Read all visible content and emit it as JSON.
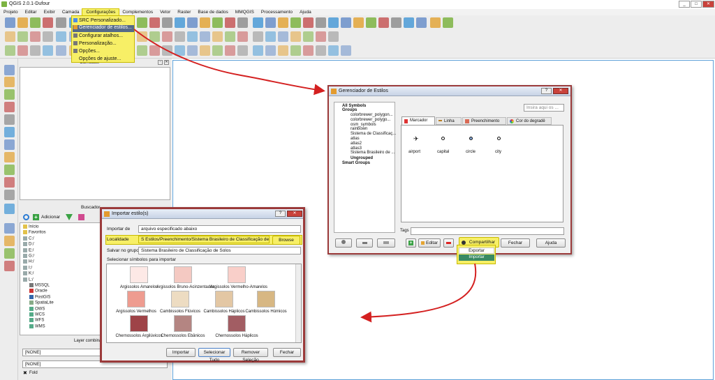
{
  "window": {
    "title": "QGIS 2.0.1-Dufour"
  },
  "menubar": {
    "items": [
      "Projeto",
      "Editar",
      "Exibir",
      "Camada",
      "Configurações",
      "Complementos",
      "Vetor",
      "Raster",
      "Base de dados",
      "MMQGIS",
      "Processamento",
      "Ajuda"
    ]
  },
  "config_menu": {
    "items": [
      "SRC Personalizado...",
      "Gerenciador de estilos...",
      "Configurar atalhos...",
      "Personalização...",
      "Opções...",
      "Opções de ajuste..."
    ]
  },
  "layers_panel": {
    "title": "Camadas"
  },
  "browser_panel": {
    "title": "Buscador",
    "add_label": "Adicionar",
    "items": [
      "Início",
      "Favoritos",
      "C:/",
      "D:/",
      "E:/",
      "G:/",
      "H:/",
      "I:/",
      "K:/",
      "L:/",
      "MSSQL",
      "Oracle",
      "PostGIS",
      "SpatiaLite",
      "OWS",
      "WCS",
      "WFS",
      "WMS"
    ]
  },
  "bottom": {
    "layer_combo_label": "Layer combinati",
    "none1": "[NONE]",
    "none2": "[NONE]",
    "fold_label": "Fold"
  },
  "style_manager": {
    "title": "Gerenciador de Estilos",
    "search_placeholder": "Insira aqui os ...",
    "tree": {
      "all": "All Symbols",
      "groups": "Groups",
      "group_items": [
        "colorbrewer_polygon...",
        "colorbrewer_polygo...",
        "osm_symbols",
        "rainbown",
        "Sistema de Classificaç...",
        "atlas",
        "atlas2",
        "atlas3",
        "Sistema Brasileiro de ..."
      ],
      "ungrouped": "Ungrouped",
      "smart": "Smart Groups"
    },
    "tabs": [
      "Marcador",
      "Linha",
      "Preenchimento",
      "Cor do degradê"
    ],
    "symbols": [
      "airport",
      "capital",
      "circle",
      "city"
    ],
    "tags_label": "Tags",
    "buttons": {
      "editar": "Editar",
      "compartilhar": "Compartilhar",
      "fechar": "Fechar",
      "ajuda": "Ajuda"
    },
    "share_menu": [
      "Exportar",
      "Importar"
    ]
  },
  "import_dialog": {
    "title": "Importar estilo(s)",
    "importar_de_label": "Importar de",
    "importar_de_value": "arquivo especificado abaixo",
    "localidade_label": "Localidade",
    "localidade_value": "S Estilos/Preenchimento/Sistema Brasileiro de Classificação de Solos.xml",
    "browse": "Browse",
    "salvar_label": "Salvar no grupo",
    "salvar_value": "Sistema Brasileiro de Classificação de Solos",
    "selecionar_label": "Selecionar símbolos para importar",
    "symbols": [
      {
        "name": "Argissolos Amarelos",
        "color": "#fde9e6"
      },
      {
        "name": "Argissolos Bruno-Acinzentados",
        "color": "#f4c9c2"
      },
      {
        "name": "Argissolos Vermelho-Amarelos",
        "color": "#f9cfc9"
      },
      {
        "name": "Argissolos Vermelhos",
        "color": "#ee9c90"
      },
      {
        "name": "Cambissolos Flúvicos",
        "color": "#eddcc2"
      },
      {
        "name": "Cambissolos Háplicos",
        "color": "#e3c7a4"
      },
      {
        "name": "Cambissolos Húmicos",
        "color": "#d7b783"
      },
      {
        "name": "Chernossolos Argilúvicos",
        "color": "#9e4348"
      },
      {
        "name": "Chernossolos Ebânicos",
        "color": "#b48582"
      },
      {
        "name": "Chernossolos Háplicos",
        "color": "#a25d63"
      }
    ],
    "buttons": {
      "importar": "Importar",
      "selecionar_tudo": "Selecionar Tudo",
      "remover": "Remover Seleção",
      "fechar": "Fechar"
    }
  },
  "colors": {
    "highlight": "#f5f06b",
    "arrow": "#d42020"
  }
}
